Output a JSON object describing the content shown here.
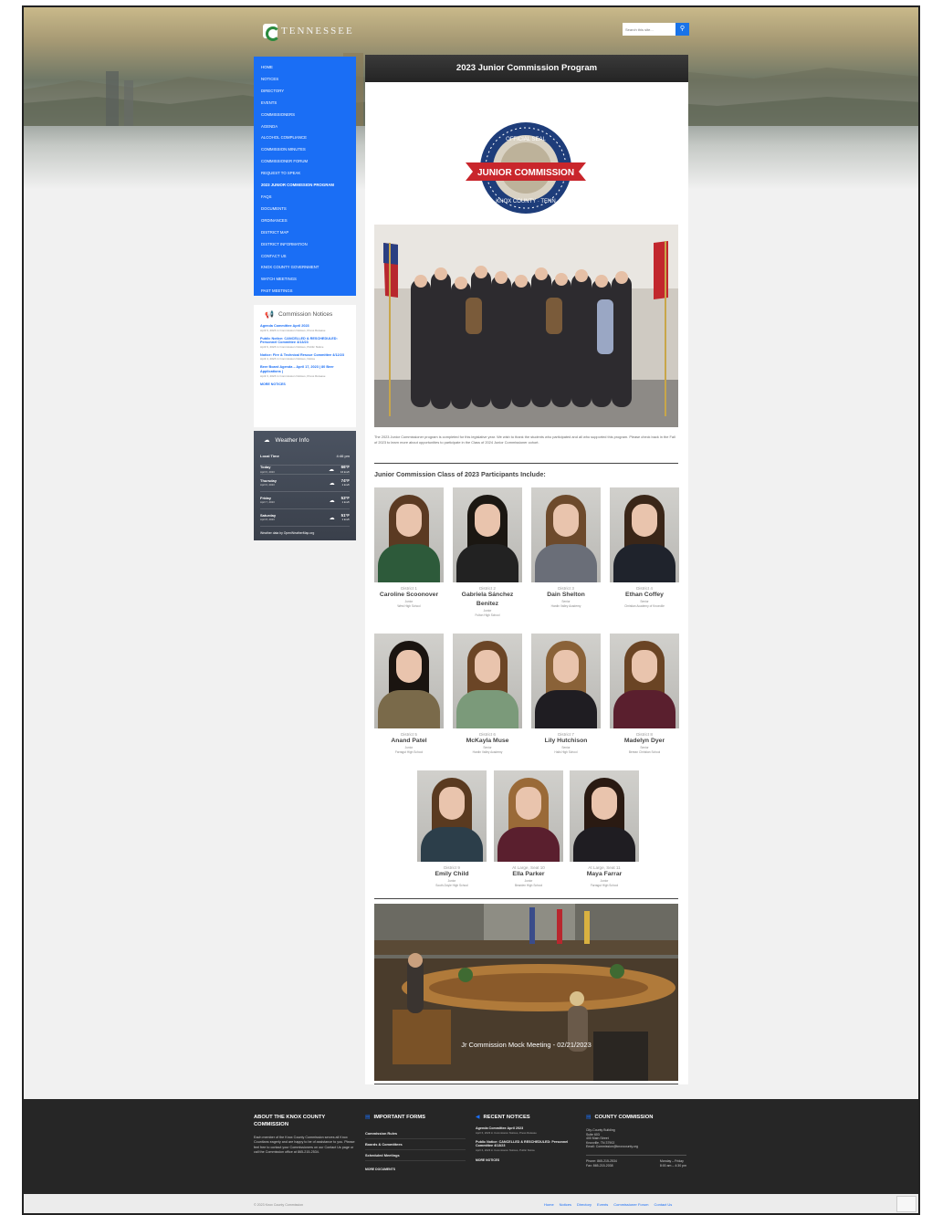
{
  "header": {
    "logo_text": "TENNESSEE",
    "search_placeholder": "Search this site...",
    "search_button_icon": "search-icon"
  },
  "nav": {
    "items": [
      {
        "label": "HOME"
      },
      {
        "label": "NOTICES"
      },
      {
        "label": "DIRECTORY"
      },
      {
        "label": "EVENTS"
      },
      {
        "label": "COMMISSIONERS"
      },
      {
        "label": "AGENDA"
      },
      {
        "label": "ALCOHOL COMPLIANCE"
      },
      {
        "label": "COMMISSION MINUTES"
      },
      {
        "label": "COMMISSIONER FORUM"
      },
      {
        "label": "REQUEST TO SPEAK"
      },
      {
        "label": "2023 JUNIOR COMMISSION PROGRAM",
        "active": true
      },
      {
        "label": "FAQS"
      },
      {
        "label": "DOCUMENTS"
      },
      {
        "label": "ORDINANCES"
      },
      {
        "label": "DISTRICT MAP"
      },
      {
        "label": "DISTRICT INFORMATION"
      },
      {
        "label": "CONTACT US"
      },
      {
        "label": "KNOX COUNTY GOVERNMENT"
      },
      {
        "label": "WATCH MEETINGS"
      },
      {
        "label": "PAST MEETINGS"
      }
    ]
  },
  "notices": {
    "title": "Commission Notices",
    "items": [
      {
        "title": "Agenda Committee April 2023",
        "meta": "April 6, 2023 in Commission Notices, Press Release"
      },
      {
        "title": "Public Notice: CANCELLED & RESCHEDULED: Personnel Committee 4/13/23",
        "meta": "April 6, 2023 in Commission Notices, Public Notice"
      },
      {
        "title": "Notice: Fire & Technical Rescue Committee 4/12/23",
        "meta": "April 4, 2023 in Commission Notices, Notice"
      },
      {
        "title": "Beer Board Agenda – April 17, 2023 | 80 Beer Applications |",
        "meta": "April 3, 2023 in Commission Notices, Press Release"
      }
    ],
    "more": "MORE NOTICES"
  },
  "weather": {
    "title": "Weather Info",
    "local_label": "Local Time",
    "local_time": "4:46 pm",
    "days": [
      {
        "day": "Today",
        "date": "April 6, 2023",
        "temp": "66°F",
        "sub": "16 km/h"
      },
      {
        "day": "Thursday",
        "date": "April 6, 2023",
        "temp": "74°F",
        "sub": "1 km/h"
      },
      {
        "day": "Friday",
        "date": "April 7, 2023",
        "temp": "53°F",
        "sub": "1 km/h"
      },
      {
        "day": "Saturday",
        "date": "April 8, 2023",
        "temp": "51°F",
        "sub": "1 km/h"
      }
    ],
    "credit": "Weather data by OpenWeatherMap.org"
  },
  "main": {
    "title": "2023 Junior Commission Program",
    "seal": {
      "top": "OFFICIAL SEAL",
      "middle": "JUNIOR COMMISSION",
      "bottom": "KNOX COUNTY · TENN"
    },
    "intro": "The 2023 Junior Commissioner program is completed for this legislative year. We wish to thank the students who participated and all who supported this program. Please check back in the Fall of 2023 to learn more about opportunities to participate in the Class of 2024 Junior Commissioner cohort.",
    "participants_heading": "Junior Commission Class of 2023 Participants Include:",
    "participants": [
      {
        "district": "District 1",
        "name": "Caroline Scoonover",
        "grade": "Junior",
        "school": "West High School"
      },
      {
        "district": "District 2",
        "name": "Gabriela Sánchez Benitez",
        "grade": "Junior",
        "school": "Fulton High School"
      },
      {
        "district": "District 3",
        "name": "Dain Shelton",
        "grade": "Senior",
        "school": "Hardin Valley Academy"
      },
      {
        "district": "District 4",
        "name": "Ethan Coffey",
        "grade": "Senior",
        "school": "Christian Academy of Knoxville"
      },
      {
        "district": "District 5",
        "name": "Anand Patel",
        "grade": "Junior",
        "school": "Farragut High School"
      },
      {
        "district": "District 6",
        "name": "McKayla Muse",
        "grade": "Senior",
        "school": "Hardin Valley Academy"
      },
      {
        "district": "District 7",
        "name": "Lily Hutchison",
        "grade": "Senior",
        "school": "Halls High School"
      },
      {
        "district": "District 8",
        "name": "Madelyn Dyer",
        "grade": "Senior",
        "school": "Berean Christian School"
      },
      {
        "district": "District 9",
        "name": "Emily Child",
        "grade": "Junior",
        "school": "South-Doyle High School"
      },
      {
        "district": "At Large, Seat 10",
        "name": "Ella Parker",
        "grade": "Junior",
        "school": "Bearden High School"
      },
      {
        "district": "At Large, Seat 11",
        "name": "Maya Farrar",
        "grade": "Junior",
        "school": "Farragut High School"
      }
    ],
    "slideshow_caption": "Jr Commission Mock Meeting - 02/21/2023"
  },
  "footer": {
    "about": {
      "title": "ABOUT THE KNOX COUNTY COMMISSION",
      "text": "Each member of the Knox County Commission serves all Knox Countians eagerly and are happy to be of assistance to you. Please feel free to contact your Commissioners on our Contact Us page or call the Commission office at 865-215-2534."
    },
    "forms": {
      "title": "IMPORTANT FORMS",
      "links": [
        "Commission Rules",
        "Boards & Committees",
        "Scheduled Meetings"
      ],
      "more": "MORE DOCUMENTS"
    },
    "recent": {
      "title": "RECENT NOTICES",
      "items": [
        {
          "title": "Agenda Committee April 2023",
          "meta": "April 6, 2023 in Commission Notices, Press Release"
        },
        {
          "title": "Public Notice: CANCELLED & RESCHEDULED: Personnel Committee 4/13/23",
          "meta": "April 6, 2023 in Commission Notices, Public Notice"
        }
      ],
      "more": "MORE NOTICES"
    },
    "county": {
      "title": "COUNTY COMMISSION",
      "address": [
        "City-County Building",
        "Suite 603",
        "400 Main Street",
        "Knoxville, TN 37902",
        "Email: Commission@knoxcounty.org"
      ],
      "phone": "Phone: 865-215-2534",
      "fax": "Fax: 865-215-2038",
      "days": "Monday – Friday",
      "hours": "8:00 am – 4:30 pm"
    }
  },
  "bottom": {
    "copyright": "© 2023 Knox County Commission",
    "links": [
      "Home",
      "Notices",
      "Directory",
      "Events",
      "Commissioner Forum",
      "Contact Us"
    ]
  },
  "colors": {
    "accent": "#1a6ef5",
    "dark": "#262626"
  }
}
